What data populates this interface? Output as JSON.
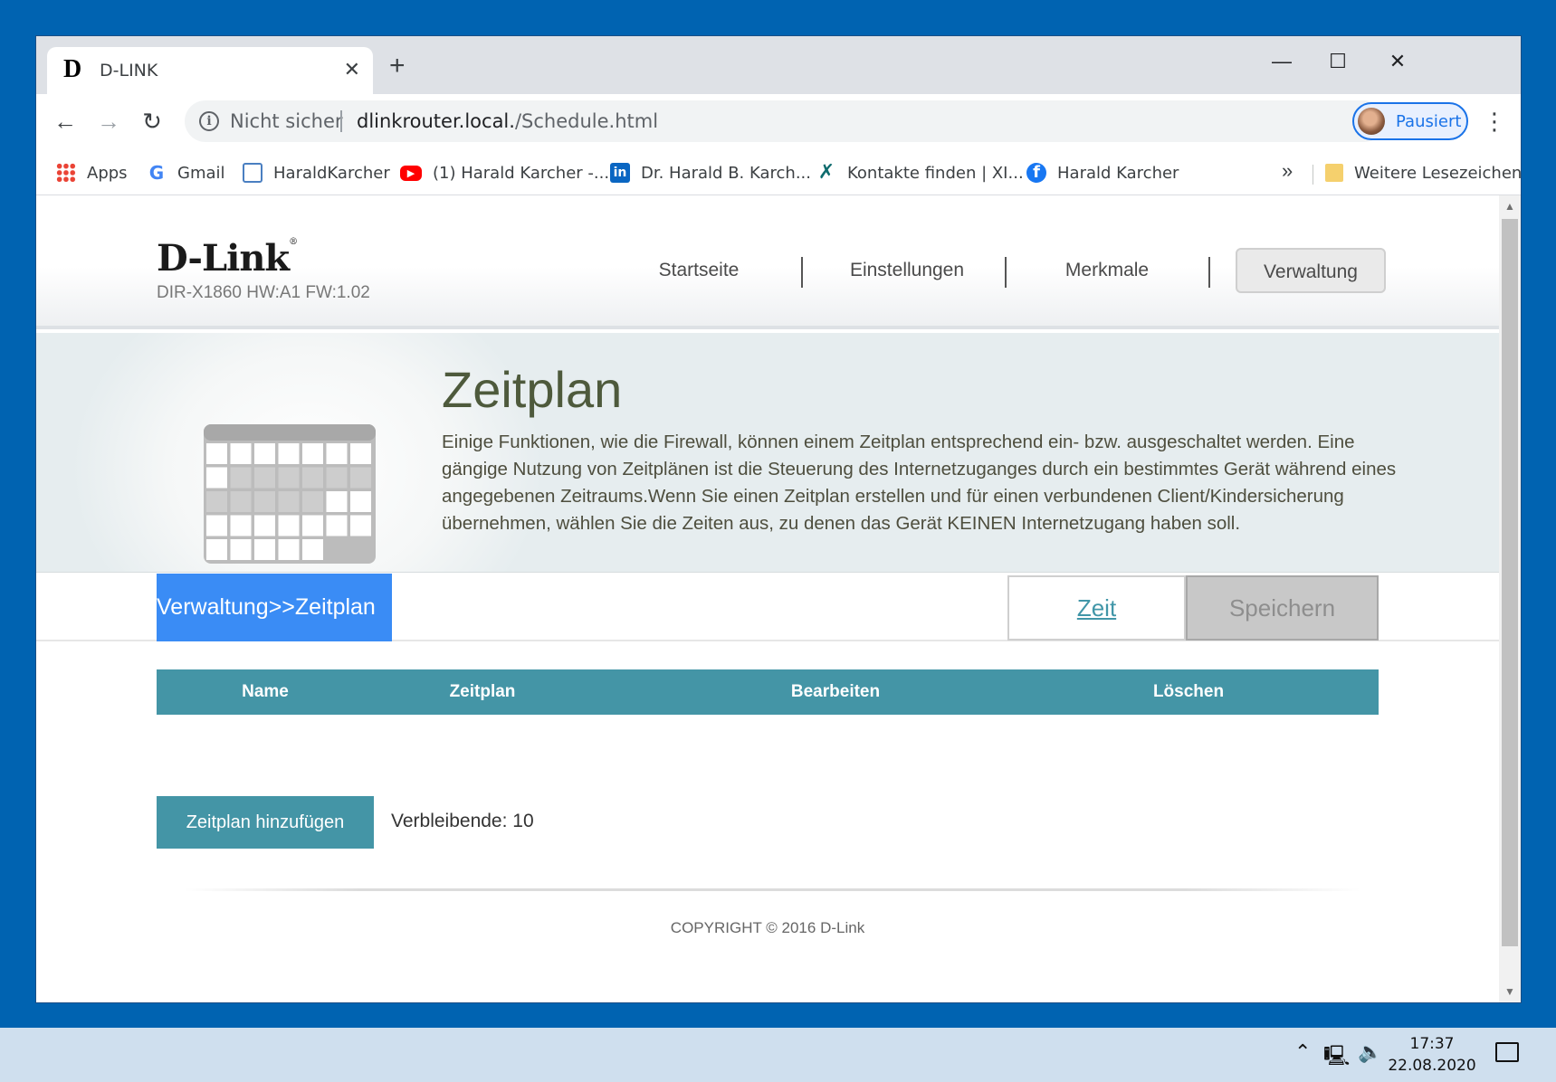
{
  "browser": {
    "tab_title": "D-LINK",
    "tab_favicon": "D",
    "address": {
      "security_label": "Nicht sicher",
      "host": "dlinkrouter.local.",
      "path": "/Schedule.html"
    },
    "profile_label": "Pausiert",
    "bookmarks": [
      {
        "label": "Apps",
        "icon": "apps-grid-icon"
      },
      {
        "label": "Gmail",
        "icon": "google-icon"
      },
      {
        "label": "HaraldKarcher",
        "icon": "page-icon"
      },
      {
        "label": "(1) Harald Karcher -...",
        "icon": "youtube-icon"
      },
      {
        "label": "Dr. Harald B. Karch...",
        "icon": "linkedin-icon"
      },
      {
        "label": "Kontakte finden | XI...",
        "icon": "xing-icon"
      },
      {
        "label": "Harald Karcher",
        "icon": "facebook-icon"
      }
    ],
    "bookmarks_more": "»",
    "other_bookmarks": "Weitere Lesezeichen"
  },
  "router": {
    "logo": "D-Link",
    "model": "DIR-X1860 HW:A1 FW:1.02",
    "nav": [
      "Startseite",
      "Einstellungen",
      "Merkmale",
      "Verwaltung"
    ],
    "active_nav": "Verwaltung"
  },
  "banner": {
    "title": "Zeitplan",
    "description": "Einige Funktionen, wie die Firewall, können einem Zeitplan entsprechend ein- bzw. ausgeschaltet werden. Eine gängige Nutzung von Zeitplänen ist die Steuerung des Internetzuganges durch ein bestimmtes Gerät während eines angegebenen Zeitraums.Wenn Sie einen Zeitplan erstellen und für einen verbundenen Client/Kindersicherung übernehmen, wählen Sie die Zeiten aus, zu denen das Gerät KEINEN Internetzugang haben soll."
  },
  "subbar": {
    "breadcrumb": "Verwaltung>>Zeitplan",
    "time_link": "Zeit",
    "save_button": "Speichern"
  },
  "table": {
    "headers": [
      "Name",
      "Zeitplan",
      "Bearbeiten",
      "Löschen"
    ],
    "rows": []
  },
  "actions": {
    "add_button": "Zeitplan hinzufügen",
    "remaining": "Verbleibende: 10"
  },
  "footer": {
    "copyright": "COPYRIGHT © 2016 D-Link"
  },
  "taskbar": {
    "time": "17:37",
    "date": "22.08.2020"
  },
  "colors": {
    "accent_teal": "#4495a6",
    "breadcrumb_blue": "#3a8cf5",
    "desktop_blue": "#0063b1"
  }
}
